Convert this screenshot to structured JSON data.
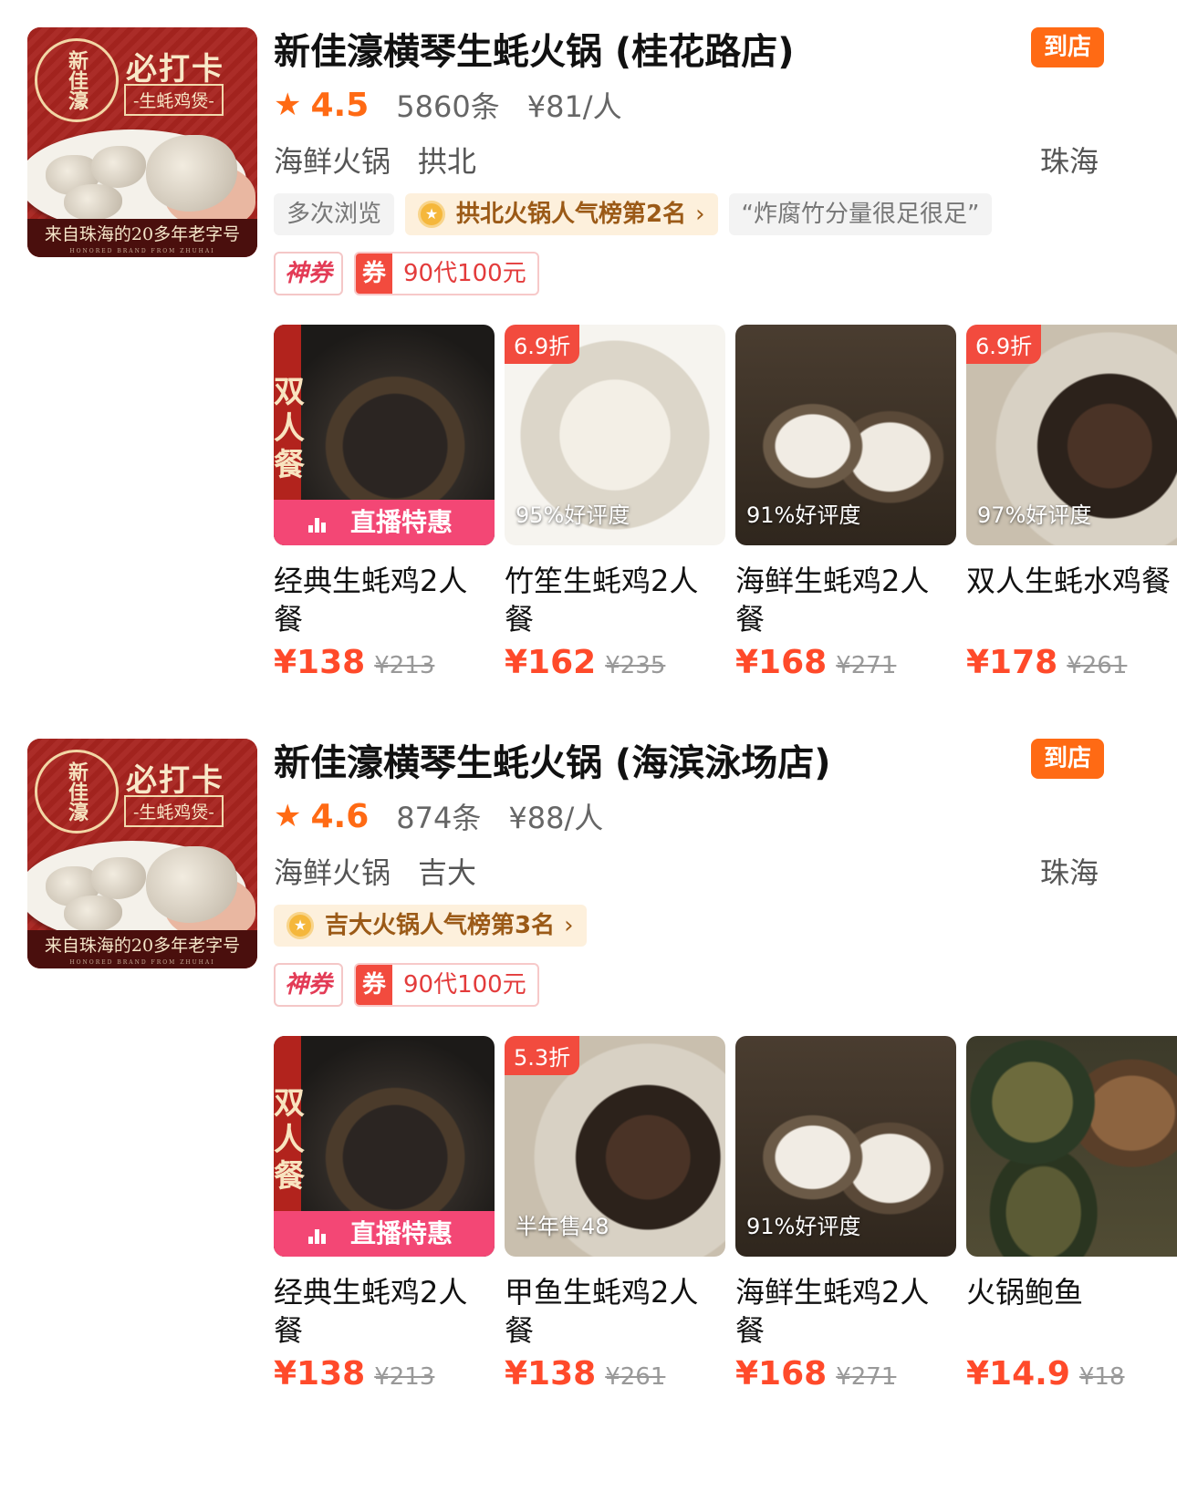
{
  "listings": [
    {
      "logo": {
        "seal": "新佳濠",
        "checkin": "必打卡",
        "subtitle": "-生蚝鸡煲-",
        "tagline": "来自珠海的20多年老字号",
        "tagline_en": "HONORED BRAND FROM ZHUHAI"
      },
      "name": "新佳濠横琴生蚝火锅 (桂花路店)",
      "instore_badge": "到店",
      "star_icon": "star-icon",
      "rating": "4.5",
      "reviews": "5860条",
      "avg_price": "¥81/人",
      "category": "海鲜火锅",
      "area": "拱北",
      "city": "珠海",
      "tags": {
        "viewed": "多次浏览",
        "rank": "拱北火锅人气榜第2名",
        "quote": "“炸腐竹分量很足很足”"
      },
      "coupon": {
        "shenquan": "神券",
        "quan": "券",
        "text": "90代100元"
      },
      "deals": [
        {
          "title": "经典生蚝鸡2人餐",
          "price": "¥138",
          "original": "¥213",
          "vertical": "双人餐",
          "live": "直播特惠"
        },
        {
          "title": "竹笙生蚝鸡2人餐",
          "price": "¥162",
          "original": "¥235",
          "discount": "6.9折",
          "overlay": "95%好评度"
        },
        {
          "title": "海鲜生蚝鸡2人餐",
          "price": "¥168",
          "original": "¥271",
          "overlay": "91%好评度"
        },
        {
          "title": "双人生蚝水鸡餐",
          "price": "¥178",
          "original": "¥261",
          "discount": "6.9折",
          "overlay": "97%好评度"
        }
      ]
    },
    {
      "logo": {
        "seal": "新佳濠",
        "checkin": "必打卡",
        "subtitle": "-生蚝鸡煲-",
        "tagline": "来自珠海的20多年老字号",
        "tagline_en": "HONORED BRAND FROM ZHUHAI"
      },
      "name": "新佳濠横琴生蚝火锅 (海滨泳场店)",
      "instore_badge": "到店",
      "star_icon": "star-icon",
      "rating": "4.6",
      "reviews": "874条",
      "avg_price": "¥88/人",
      "category": "海鲜火锅",
      "area": "吉大",
      "city": "珠海",
      "tags": {
        "rank": "吉大火锅人气榜第3名"
      },
      "coupon": {
        "shenquan": "神券",
        "quan": "券",
        "text": "90代100元"
      },
      "deals": [
        {
          "title": "经典生蚝鸡2人餐",
          "price": "¥138",
          "original": "¥213",
          "vertical": "双人餐",
          "live": "直播特惠"
        },
        {
          "title": "甲鱼生蚝鸡2人餐",
          "price": "¥138",
          "original": "¥261",
          "discount": "5.3折",
          "overlay": "半年售48"
        },
        {
          "title": "海鲜生蚝鸡2人餐",
          "price": "¥168",
          "original": "¥271",
          "overlay": "91%好评度"
        },
        {
          "title": "火锅鲍鱼",
          "price": "¥14.9",
          "original": "¥18"
        }
      ]
    }
  ],
  "colors": {
    "accent": "#ff6a14",
    "price": "#ff4a2a",
    "live": "#f34775",
    "coupon": "#f24b3e"
  }
}
